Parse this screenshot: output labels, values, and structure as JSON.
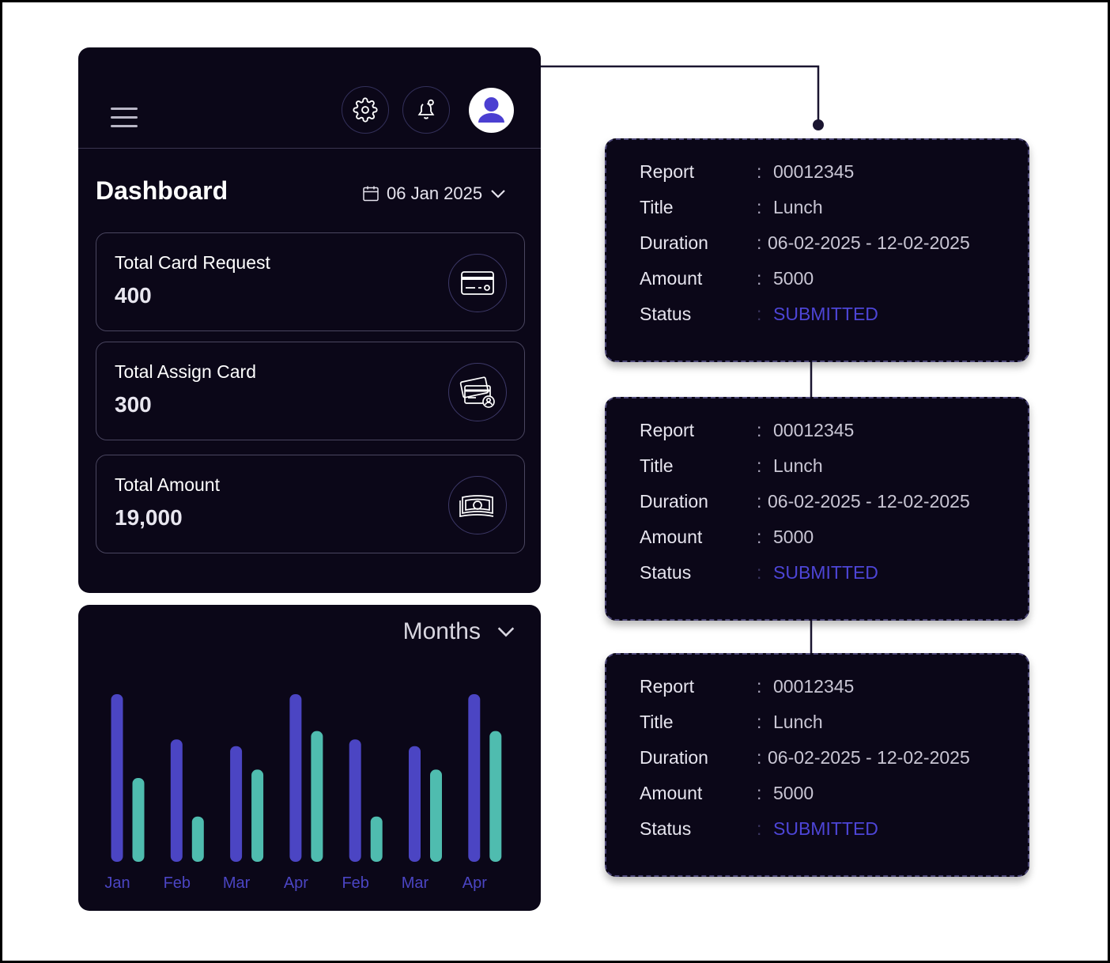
{
  "dashboard": {
    "title": "Dashboard",
    "date": "06 Jan 2025",
    "stats": [
      {
        "label": "Total Card Request",
        "value": "400",
        "icon": "credit-card-icon"
      },
      {
        "label": "Total Assign Card",
        "value": "300",
        "icon": "assign-card-icon"
      },
      {
        "label": "Total Amount",
        "value": "19,000",
        "icon": "cash-icon"
      }
    ]
  },
  "header": {
    "icons": [
      "menu-icon",
      "gear-icon",
      "bell-icon",
      "user-avatar-icon"
    ]
  },
  "chart": {
    "selector": "Months"
  },
  "chart_data": {
    "type": "bar",
    "categories": [
      "Jan",
      "Feb",
      "Mar",
      "Apr",
      "Feb",
      "Mar",
      "Apr"
    ],
    "series": [
      {
        "values": [
          100,
          73,
          69,
          100,
          73,
          69,
          100
        ]
      },
      {
        "values": [
          50,
          27,
          55,
          78,
          27,
          55,
          78
        ]
      }
    ],
    "colors": [
      "#4b45c3",
      "#4fbcaf"
    ],
    "title": "",
    "xlabel": "",
    "ylabel": "",
    "ylim": [
      0,
      100
    ],
    "grid": false
  },
  "reports": [
    {
      "report_label": "Report",
      "report": "00012345",
      "title_label": "Title",
      "title": "Lunch",
      "duration_label": "Duration",
      "duration": "06-02-2025 - 12-02-2025",
      "amount_label": "Amount",
      "amount": "5000",
      "status_label": "Status",
      "status": "SUBMITTED",
      "colon": ":"
    },
    {
      "report_label": "Report",
      "report": "00012345",
      "title_label": "Title",
      "title": "Lunch",
      "duration_label": "Duration",
      "duration": "06-02-2025 - 12-02-2025",
      "amount_label": "Amount",
      "amount": "5000",
      "status_label": "Status",
      "status": "SUBMITTED",
      "colon": ":"
    },
    {
      "report_label": "Report",
      "report": "00012345",
      "title_label": "Title",
      "title": "Lunch",
      "duration_label": "Duration",
      "duration": "06-02-2025 - 12-02-2025",
      "amount_label": "Amount",
      "amount": "5000",
      "status_label": "Status",
      "status": "SUBMITTED",
      "colon": ":"
    }
  ],
  "colors": {
    "panel_bg": "#0b0718",
    "accent_purple": "#4b45c3",
    "accent_teal": "#4fbcaf",
    "status": "#4d45d6"
  }
}
